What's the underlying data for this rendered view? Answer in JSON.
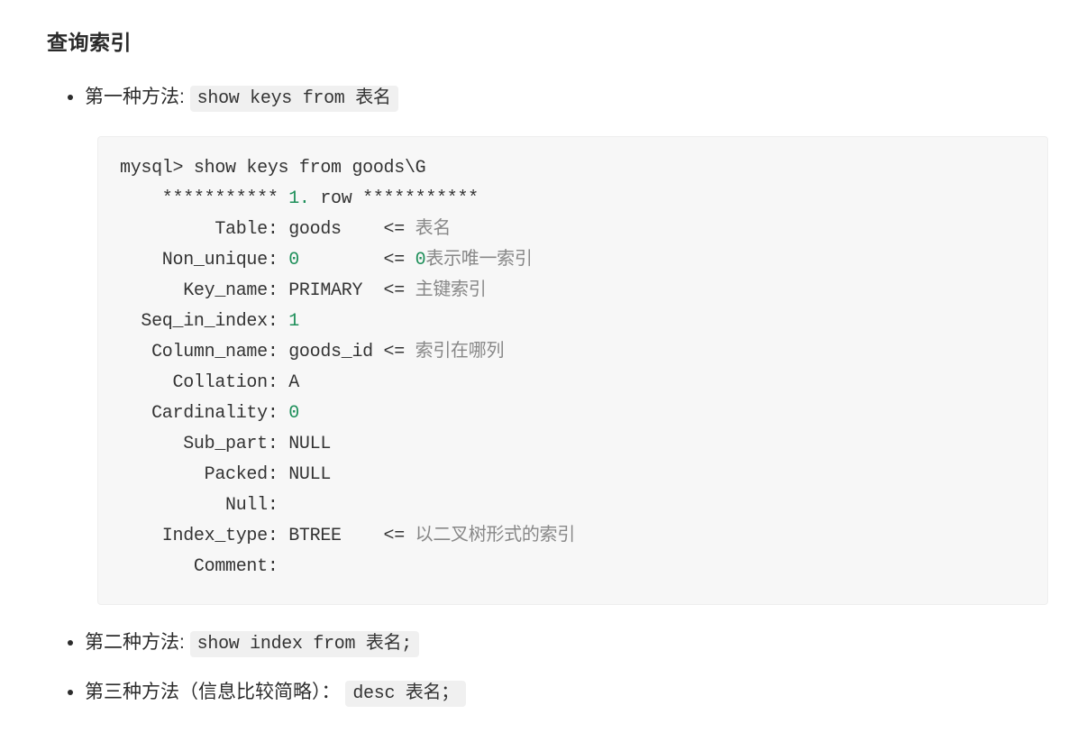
{
  "heading": "查询索引",
  "methods": {
    "m1": {
      "label_prefix": "第一种方法: ",
      "code": "show keys from 表名"
    },
    "m2": {
      "label_prefix": "第二种方法: ",
      "code": "show index from 表名;"
    },
    "m3": {
      "label_prefix": "第三种方法（信息比较简略）：",
      "code": "desc 表名；"
    }
  },
  "codeblock": {
    "l0": "mysql> show keys from goods\\G",
    "l1a": "    *********** ",
    "l1b": "1.",
    "l1c": " row ***********",
    "l2a": "         Table: goods    <= ",
    "l2b": "表名",
    "l3a": "    Non_unique: ",
    "l3b": "0",
    "l3c": "        <= ",
    "l3d": "0",
    "l3e": "表示唯一索引",
    "l4a": "      Key_name: PRIMARY  <= ",
    "l4b": "主键索引",
    "l5a": "  Seq_in_index: ",
    "l5b": "1",
    "l6a": "   Column_name: goods_id <= ",
    "l6b": "索引在哪列",
    "l7": "     Collation: A",
    "l8a": "   Cardinality: ",
    "l8b": "0",
    "l9": "      Sub_part: NULL",
    "l10": "        Packed: NULL",
    "l11": "          Null:",
    "l12a": "    Index_type: BTREE    <= ",
    "l12b": "以二叉树形式的索引",
    "l13": "       Comment:"
  }
}
